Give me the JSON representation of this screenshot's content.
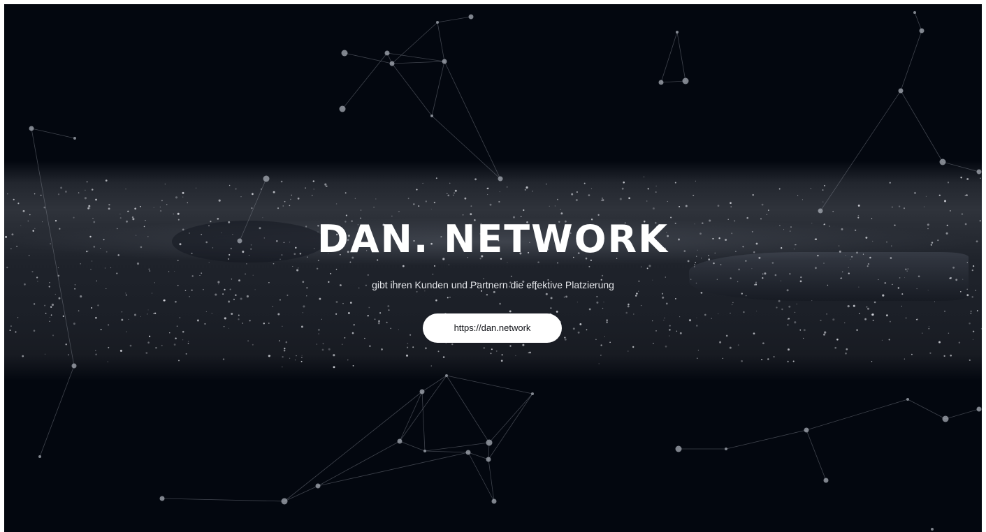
{
  "hero": {
    "title": "DAN. NETWORK",
    "tagline": "gibt ihren Kunden und Partnern die effektive Platzierung",
    "cta_label": "https://dan.network"
  },
  "colors": {
    "background": "#03070f",
    "text": "#ffffff",
    "button_background": "#ffffff",
    "button_text": "#111318",
    "network_lines": "#8a8f98"
  }
}
